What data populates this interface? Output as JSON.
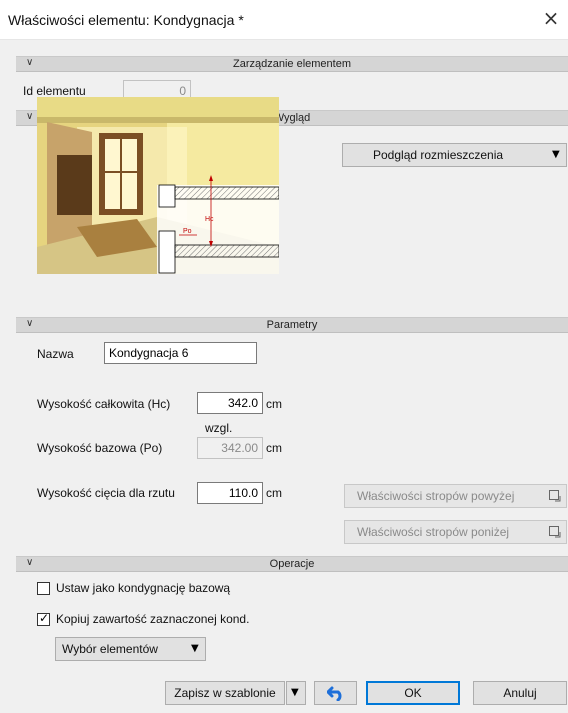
{
  "window": {
    "title": "Właściwości elementu: Kondygnacja *",
    "close_glyph": "×"
  },
  "sections": {
    "management": {
      "label": "Zarządzanie elementem"
    },
    "appearance": {
      "label": "Wygląd"
    },
    "parameters": {
      "label": "Parametry"
    },
    "operations": {
      "label": "Operacje"
    }
  },
  "management": {
    "id_label": "Id elementu",
    "id_value": "0"
  },
  "appearance": {
    "preview_dropdown": "Podgląd rozmieszczenia",
    "dim_hc": "Hc",
    "dim_po": "Po"
  },
  "parameters": {
    "name_label": "Nazwa",
    "name_value": "Kondygnacja 6",
    "total_height_label": "Wysokość całkowita (Hc)",
    "total_height_value": "342.0",
    "total_height_unit": "cm",
    "relative_label": "wzgl.",
    "base_height_label": "Wysokość bazowa (Po)",
    "base_height_value": "342.00",
    "base_height_unit": "cm",
    "cut_height_label": "Wysokość cięcia dla rzutu",
    "cut_height_value": "110.0",
    "cut_height_unit": "cm",
    "ceilings_above": "Właściwości stropów powyżej",
    "ceilings_below": "Właściwości stropów poniżej"
  },
  "operations": {
    "set_base_label": "Ustaw jako kondygnację bazową",
    "set_base_checked": false,
    "copy_label": "Kopiuj zawartość zaznaczonej kond.",
    "copy_checked": true,
    "select_elements": "Wybór elementów"
  },
  "footer": {
    "save_template": "Zapisz w szablonie",
    "ok": "OK",
    "cancel": "Anuluj"
  },
  "colors": {
    "section_header": "#d5d5d5",
    "dialog_bg": "#f0f0f0",
    "ok_border": "#0078d7",
    "undo_icon": "#1e6fd9"
  }
}
